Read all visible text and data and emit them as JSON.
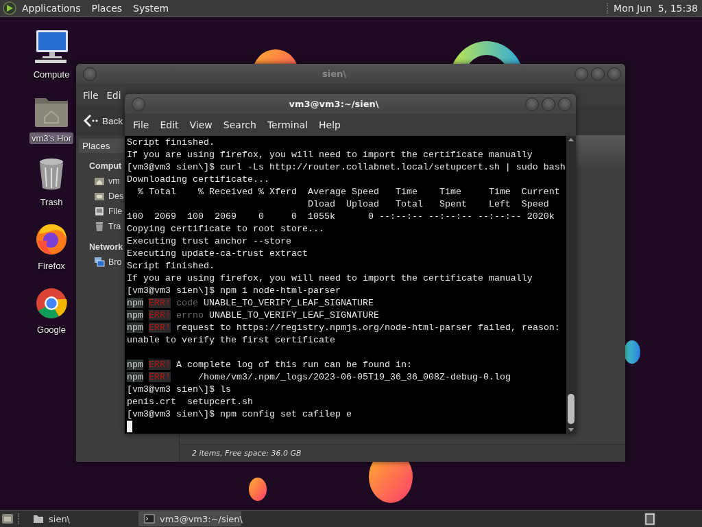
{
  "top_panel": {
    "menus": [
      "Applications",
      "Places",
      "System"
    ],
    "clock": "Mon Jun  5, 15:38"
  },
  "desktop_icons": [
    {
      "label": "Compute",
      "kind": "computer",
      "selected": false
    },
    {
      "label": "vm3's Hor",
      "kind": "home",
      "selected": true
    },
    {
      "label": "Trash",
      "kind": "trash",
      "selected": false
    },
    {
      "label": "Firefox",
      "kind": "firefox",
      "selected": false
    },
    {
      "label": "Google",
      "kind": "chrome",
      "selected": false
    }
  ],
  "file_manager": {
    "title": "sien\\",
    "menus": [
      "File",
      "Edi"
    ],
    "back": "Back",
    "sidebar_tab": "Places",
    "sections": [
      {
        "heading": "Comput",
        "items": [
          {
            "label": "vm",
            "kind": "home"
          },
          {
            "label": "Des",
            "kind": "desktop"
          },
          {
            "label": "File",
            "kind": "drive"
          },
          {
            "label": "Tra",
            "kind": "trash"
          }
        ]
      },
      {
        "heading": "Network",
        "items": [
          {
            "label": "Bro",
            "kind": "network"
          }
        ]
      }
    ],
    "status": "2 items, Free space: 36.0 GB"
  },
  "terminal": {
    "title": "vm3@vm3:~/sien\\",
    "menus": [
      "File",
      "Edit",
      "View",
      "Search",
      "Terminal",
      "Help"
    ],
    "lines": [
      {
        "kind": "text",
        "text": "Script finished."
      },
      {
        "kind": "text",
        "text": "If you are using firefox, you will need to import the certificate manually"
      },
      {
        "kind": "text",
        "text": "[vm3@vm3 sien\\]$ curl -Ls http://router.collabnet.local/setupcert.sh | sudo bash"
      },
      {
        "kind": "text",
        "text": "Downloading certificate..."
      },
      {
        "kind": "text",
        "text": "  % Total    % Received % Xferd  Average Speed   Time    Time     Time  Current"
      },
      {
        "kind": "text",
        "text": "                                 Dload  Upload   Total   Spent    Left  Speed"
      },
      {
        "kind": "text",
        "text": "100  2069  100  2069    0     0  1055k      0 --:--:-- --:--:-- --:--:-- 2020k"
      },
      {
        "kind": "text",
        "text": "Copying certificate to root store..."
      },
      {
        "kind": "text",
        "text": "Executing trust anchor --store"
      },
      {
        "kind": "text",
        "text": "Executing update-ca-trust extract"
      },
      {
        "kind": "text",
        "text": "Script finished."
      },
      {
        "kind": "text",
        "text": "If you are using firefox, you will need to import the certificate manually"
      },
      {
        "kind": "text",
        "text": "[vm3@vm3 sien\\]$ npm i node-html-parser"
      },
      {
        "kind": "npm_error",
        "prefix": "npm",
        "tag": "ERR!",
        "field": "code",
        "message": "UNABLE_TO_VERIFY_LEAF_SIGNATURE"
      },
      {
        "kind": "npm_error",
        "prefix": "npm",
        "tag": "ERR!",
        "field": "errno",
        "message": "UNABLE_TO_VERIFY_LEAF_SIGNATURE"
      },
      {
        "kind": "npm_error",
        "prefix": "npm",
        "tag": "ERR!",
        "message": "request to https://registry.npmjs.org/node-html-parser failed, reason:"
      },
      {
        "kind": "text",
        "text": "unable to verify the first certificate"
      },
      {
        "kind": "blank"
      },
      {
        "kind": "npm_error",
        "prefix": "npm",
        "tag": "ERR!",
        "message": "A complete log of this run can be found in:"
      },
      {
        "kind": "npm_error",
        "prefix": "npm",
        "tag": "ERR!",
        "message": "    /home/vm3/.npm/_logs/2023-06-05T19_36_36_008Z-debug-0.log"
      },
      {
        "kind": "text",
        "text": "[vm3@vm3 sien\\]$ ls"
      },
      {
        "kind": "text",
        "text": "penis.crt  setupcert.sh"
      },
      {
        "kind": "text",
        "text": "[vm3@vm3 sien\\]$ npm config set cafilep e"
      },
      {
        "kind": "cursor"
      }
    ]
  },
  "taskbar": {
    "tasks": [
      {
        "label": "sien\\",
        "kind": "folder",
        "selected": false
      },
      {
        "label": "vm3@vm3:~/sien\\",
        "kind": "terminal",
        "selected": true
      }
    ]
  }
}
